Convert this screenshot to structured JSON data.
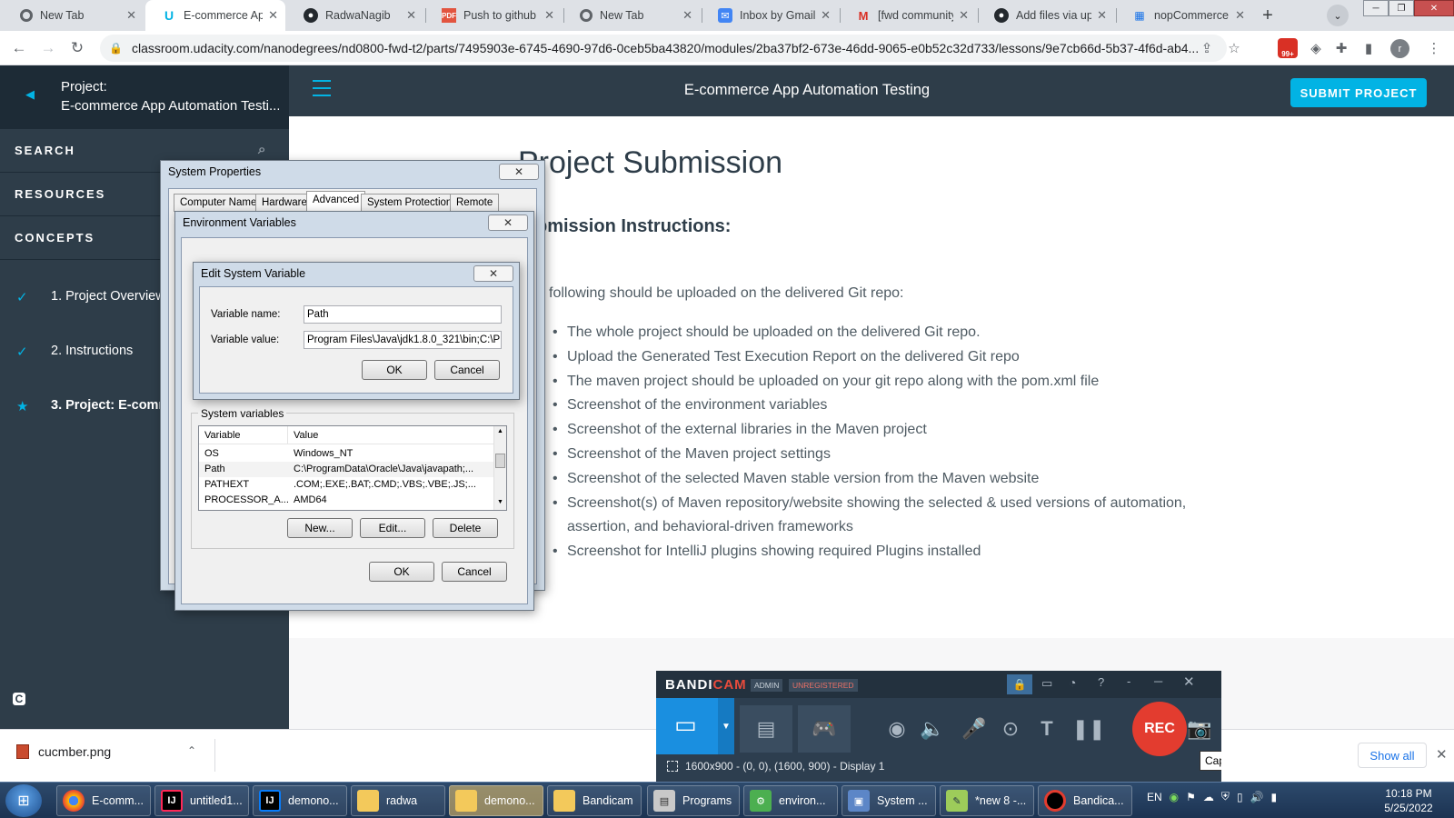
{
  "browser": {
    "tabs": [
      {
        "label": "New Tab",
        "icon": "chrome-icon",
        "active": false
      },
      {
        "label": "E-commerce App",
        "icon": "udacity-icon",
        "active": true
      },
      {
        "label": "RadwaNagib",
        "icon": "github-icon",
        "active": false
      },
      {
        "label": "Push to github",
        "icon": "pdf-icon",
        "active": false
      },
      {
        "label": "New Tab",
        "icon": "chrome-icon",
        "active": false
      },
      {
        "label": "Inbox by Gmail",
        "icon": "inbox-icon",
        "active": false
      },
      {
        "label": "[fwd community",
        "icon": "gmail-icon",
        "active": false
      },
      {
        "label": "Add files via upl",
        "icon": "github-icon",
        "active": false
      },
      {
        "label": "nopCommerce d",
        "icon": "nopcommerce-icon",
        "active": false
      }
    ],
    "url": "classroom.udacity.com/nanodegrees/nd0800-fwd-t2/parts/7495903e-6745-4690-97d6-0ceb5ba43820/modules/2ba37bf2-673e-46dd-9065-e0b52c32d733/lessons/9e7cb66d-5b37-4f6d-ab4...",
    "extension_badge": "99+",
    "profile_initial": "r"
  },
  "sidebar": {
    "project_label": "Project:",
    "project_title": "E-commerce App Automation Testi...",
    "search_label": "SEARCH",
    "resources_label": "RESOURCES",
    "concepts_label": "CONCEPTS",
    "lessons": [
      {
        "label": "1. Project Overview",
        "status": "done"
      },
      {
        "label": "2. Instructions",
        "status": "done"
      },
      {
        "label": "3. Project: E-commerce",
        "status": "current"
      }
    ]
  },
  "header": {
    "title": "E-commerce App Automation Testing",
    "submit_label": "SUBMIT PROJECT"
  },
  "content": {
    "heading": "Project Submission",
    "subheading": "bmission Instructions:",
    "intro": "following should be uploaded on the delivered Git repo:",
    "items": [
      "The whole project should be uploaded on the delivered Git repo.",
      "Upload the Generated Test Execution Report on the delivered Git repo",
      "The maven project should be uploaded on your git repo along with the pom.xml file",
      "Screenshot of the environment variables",
      "Screenshot of the external libraries in the Maven project",
      "Screenshot of the Maven project settings",
      "Screenshot of the selected Maven stable version from the Maven website",
      "Screenshot(s) of Maven repository/website showing the selected & used versions of automation, assertion, and behavioral-driven frameworks",
      "Screenshot for IntelliJ plugins showing required Plugins installed"
    ]
  },
  "system_properties": {
    "title": "System Properties",
    "tabs": [
      "Computer Name",
      "Hardware",
      "Advanced",
      "System Protection",
      "Remote"
    ],
    "selected_tab": "Advanced"
  },
  "env_vars": {
    "title": "Environment Variables",
    "system_vars_label": "System variables",
    "columns": [
      "Variable",
      "Value"
    ],
    "rows": [
      [
        "OS",
        "Windows_NT"
      ],
      [
        "Path",
        "C:\\ProgramData\\Oracle\\Java\\javapath;..."
      ],
      [
        "PATHEXT",
        ".COM;.EXE;.BAT;.CMD;.VBS;.VBE;.JS;..."
      ],
      [
        "PROCESSOR_A...",
        "AMD64"
      ]
    ],
    "new_label": "New...",
    "edit_label": "Edit...",
    "delete_label": "Delete",
    "ok_label": "OK",
    "cancel_label": "Cancel"
  },
  "edit_var": {
    "title": "Edit System Variable",
    "name_label": "Variable name:",
    "name_value": "Path",
    "value_label": "Variable value:",
    "value_value": "Program Files\\Java\\jdk1.8.0_321\\bin;C:\\Pro",
    "ok_label": "OK",
    "cancel_label": "Cancel"
  },
  "bandicam": {
    "logo_a": "BANDI",
    "logo_b": "CAM",
    "admin": "ADMIN",
    "unregistered": "UNREGISTERED",
    "rec_label": "REC",
    "status": "1600x900 - (0, 0), (1600, 900) - Display 1",
    "tooltip": "Capture Image"
  },
  "downloads": {
    "file": "cucmber.png",
    "show_all": "Show all"
  },
  "taskbar": {
    "items": [
      {
        "label": "E-comm...",
        "icon": "chrome-icon"
      },
      {
        "label": "untitled1...",
        "icon": "intellij-icon"
      },
      {
        "label": "demono...",
        "icon": "intellij-icon"
      },
      {
        "label": "radwa",
        "icon": "folder-icon"
      },
      {
        "label": "demono...",
        "icon": "folder-icon"
      },
      {
        "label": "Bandicam",
        "icon": "folder-icon"
      },
      {
        "label": "Programs",
        "icon": "programs-icon"
      },
      {
        "label": "environ...",
        "icon": "control-panel-icon"
      },
      {
        "label": "System ...",
        "icon": "system-icon"
      },
      {
        "label": "*new 8 -...",
        "icon": "notepad-icon"
      },
      {
        "label": "Bandica...",
        "icon": "record-icon"
      }
    ],
    "lang": "EN",
    "time": "10:18 PM",
    "date": "5/25/2022"
  },
  "colors": {
    "udacity_dark": "#2e3d49",
    "udacity_blue": "#02b3e4",
    "bandicam_red": "#e33c2f"
  }
}
